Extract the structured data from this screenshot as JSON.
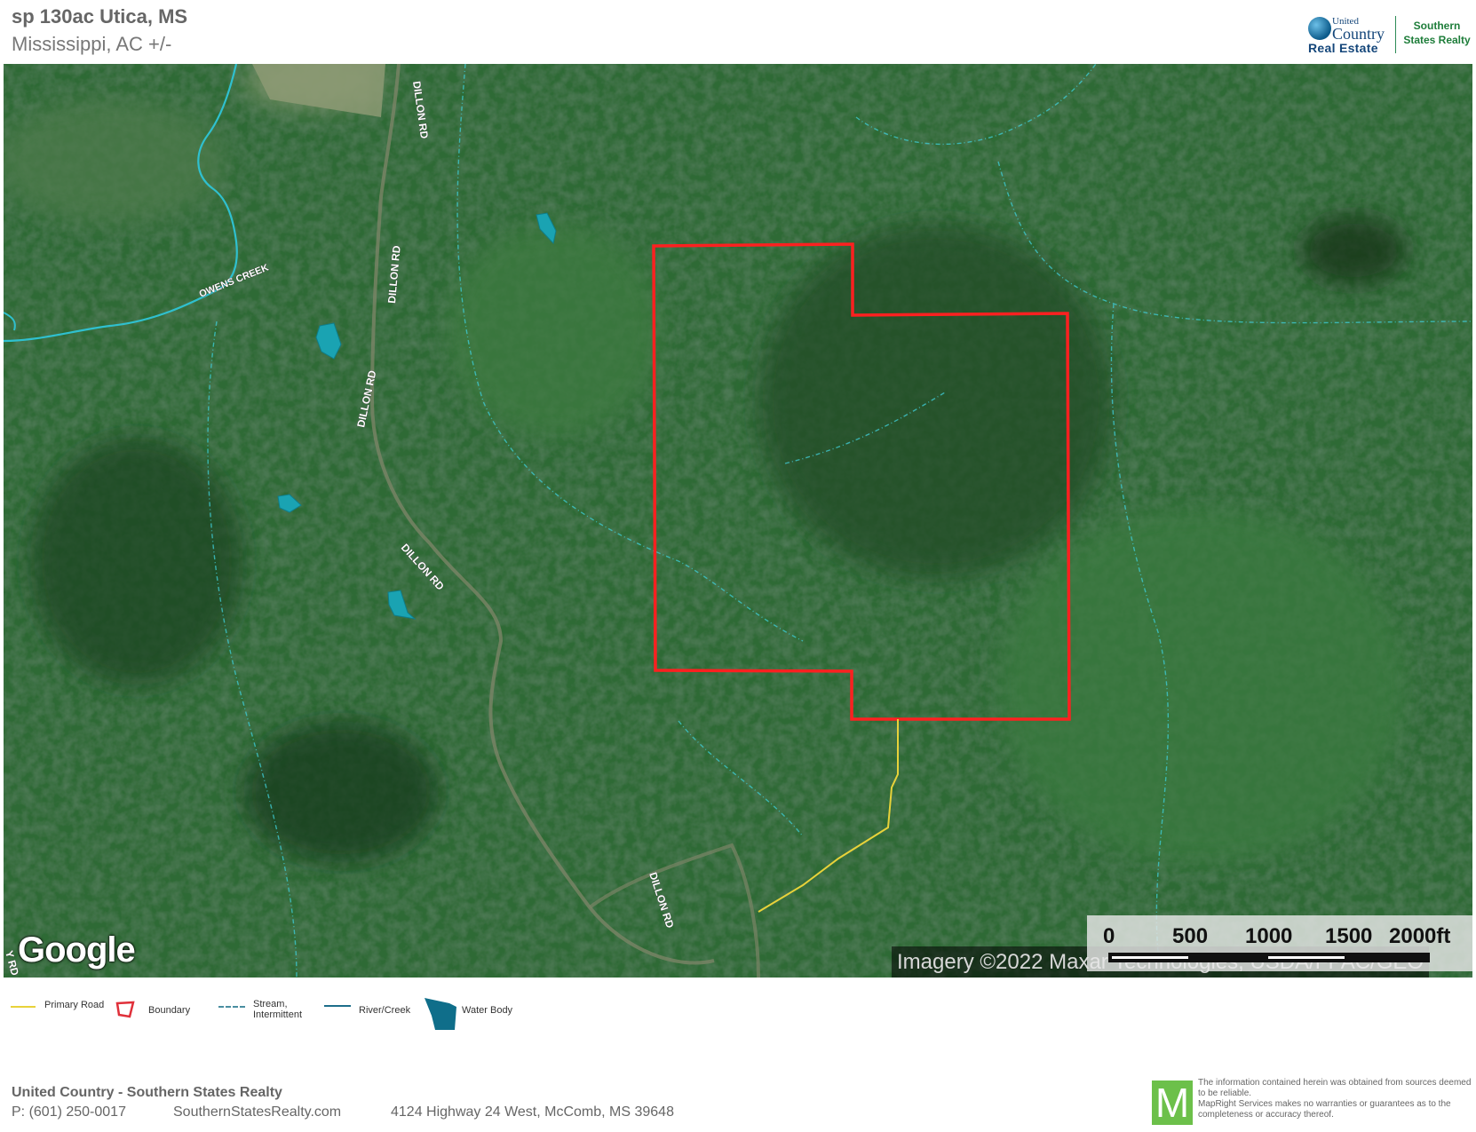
{
  "header": {
    "title": "sp 130ac Utica, MS",
    "subtitle": "Mississippi,  AC +/-"
  },
  "logo": {
    "united": "United",
    "country": "Country",
    "real_estate": "Real Estate",
    "southern": "Southern",
    "states_realty": "States Realty"
  },
  "map": {
    "road_labels": [
      "DILLON RD",
      "DILLON RD",
      "DILLON RD",
      "DILLON RD",
      "DILLON RD",
      "OWENS CREEK",
      "Y RD"
    ],
    "google_logo": "Google",
    "attribution": "Imagery ©2022 Maxar Technologies, USDA/FPAC/GEO",
    "scale": {
      "labels": [
        "0",
        "500",
        "1000",
        "1500",
        "2000ft"
      ]
    },
    "colors": {
      "boundary": "#ff2020",
      "primary_road": "#e8d23a",
      "stream": "#22c4d0",
      "water": "#1aa3b2"
    }
  },
  "legend": {
    "primary_road": "Primary Road",
    "boundary": "Boundary",
    "stream_1": "Stream,",
    "stream_2": "Intermittent",
    "river": "River/Creek",
    "water_body": "Water Body"
  },
  "footer": {
    "company": "United Country - Southern States Realty",
    "phone": "P: (601) 250-0017",
    "website": "SouthernStatesRealty.com",
    "address": "4124 Highway 24 West, McComb, MS 39648",
    "m_logo": "M",
    "disclaimer_1": "The information contained herein was obtained from sources deemed to be reliable.",
    "disclaimer_2": "MapRight Services makes no warranties or guarantees as to the completeness or accuracy thereof."
  }
}
